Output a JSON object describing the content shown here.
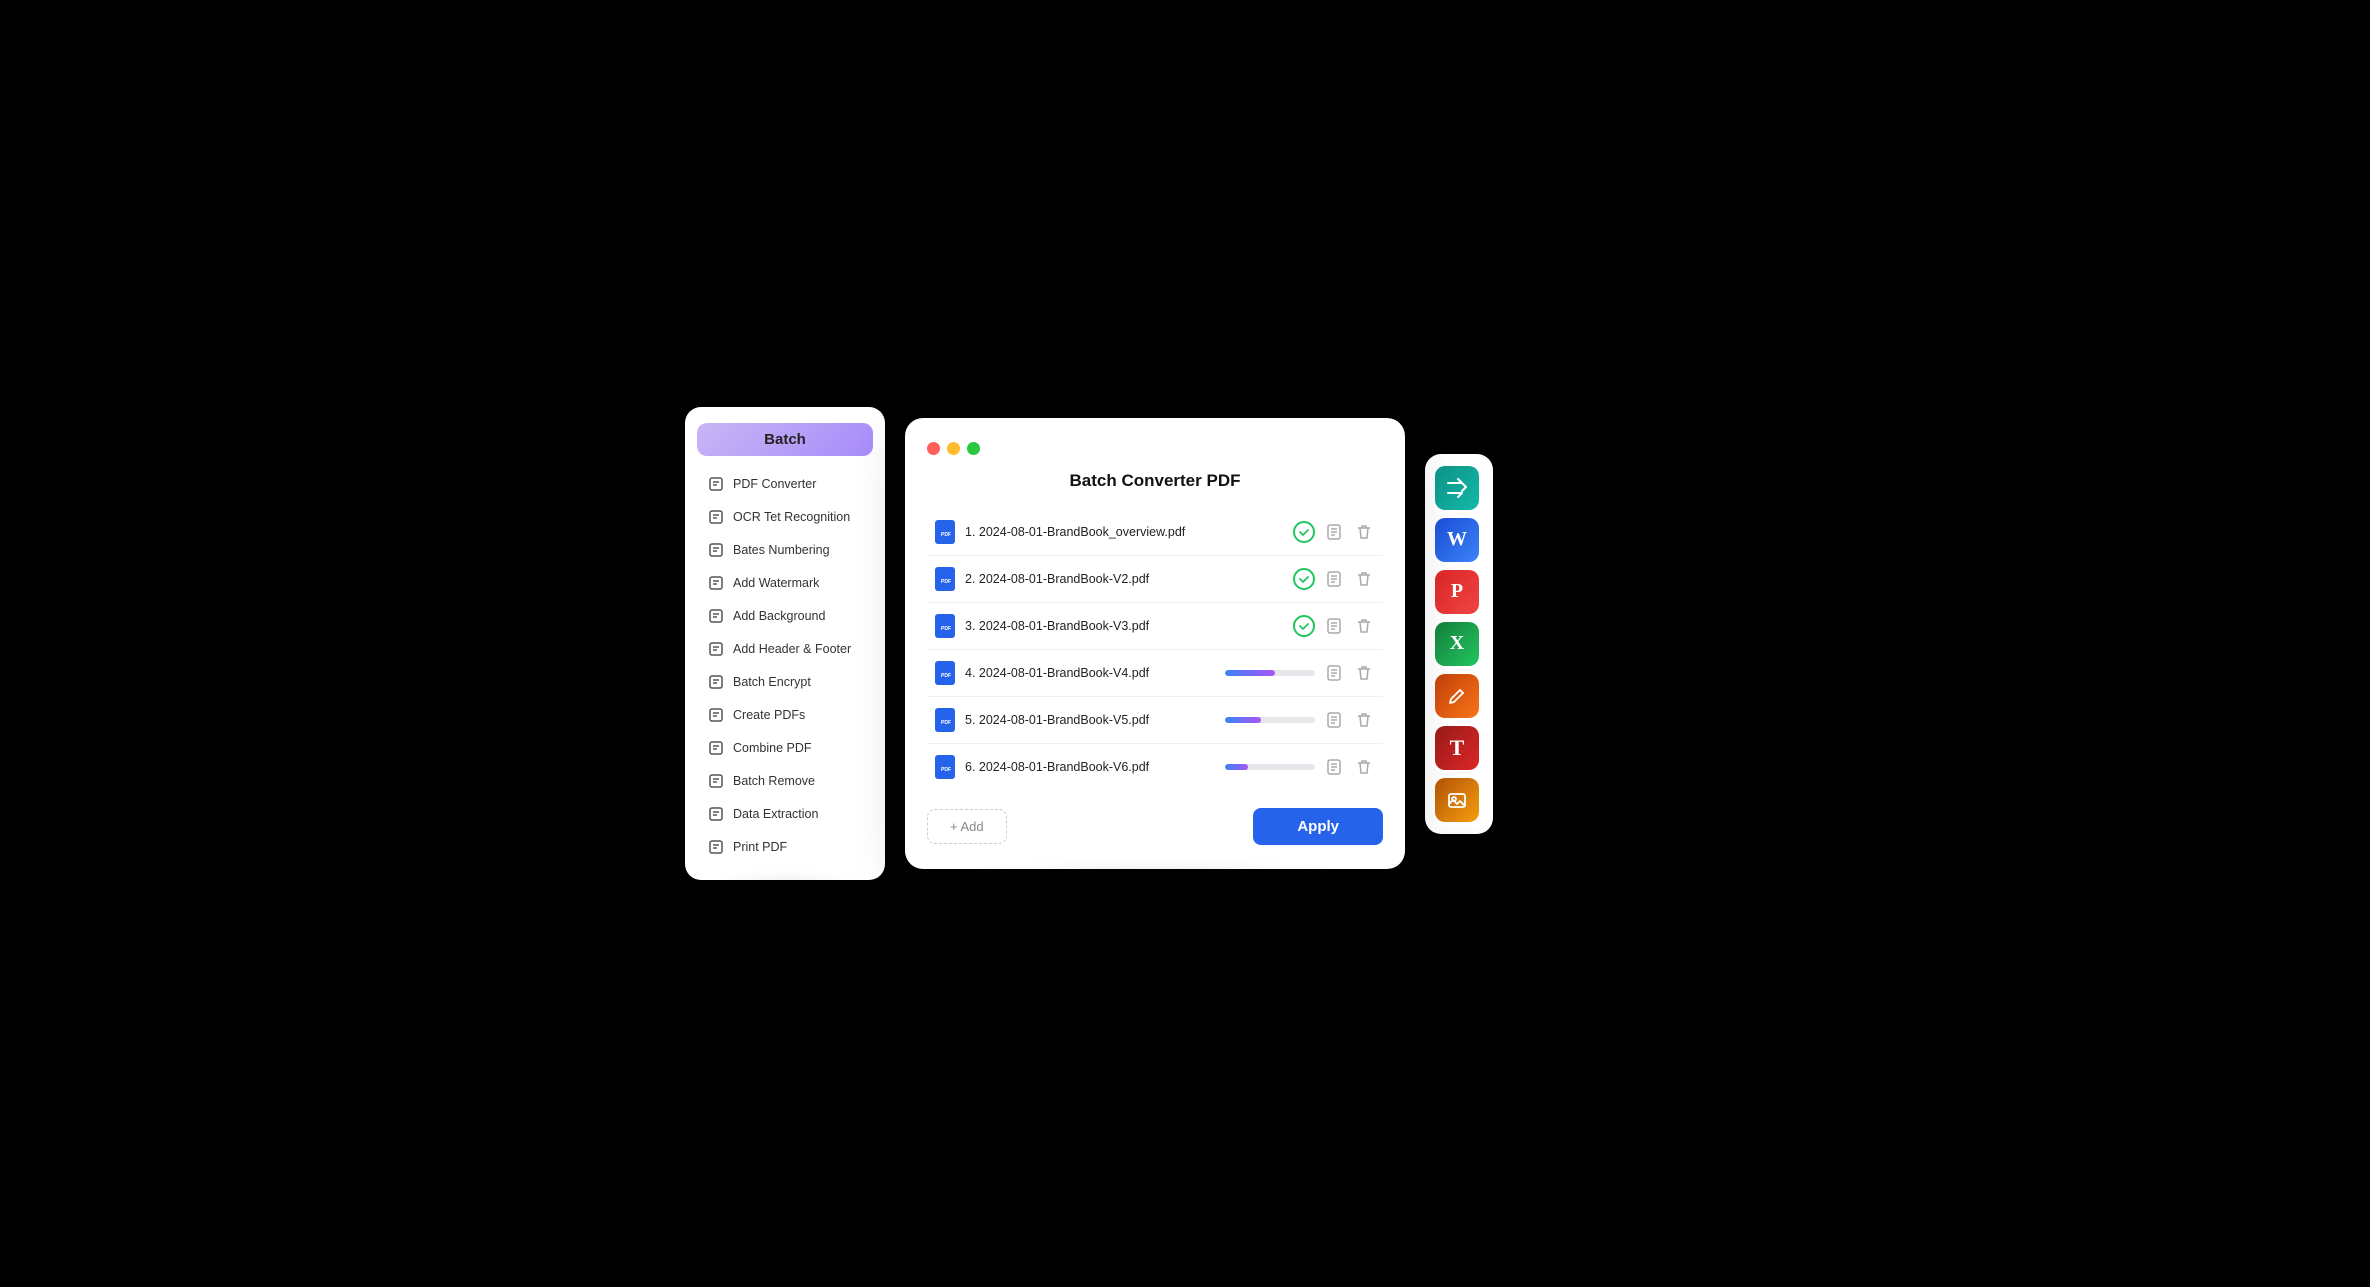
{
  "sidebar": {
    "header": "Batch",
    "items": [
      {
        "id": "pdf-converter",
        "label": "PDF Converter",
        "icon": "pdf-converter-icon"
      },
      {
        "id": "ocr-recognition",
        "label": "OCR Tet Recognition",
        "icon": "ocr-icon"
      },
      {
        "id": "bates-numbering",
        "label": "Bates Numbering",
        "icon": "bates-icon"
      },
      {
        "id": "add-watermark",
        "label": "Add Watermark",
        "icon": "watermark-icon"
      },
      {
        "id": "add-background",
        "label": "Add Background",
        "icon": "background-icon"
      },
      {
        "id": "add-header-footer",
        "label": "Add Header & Footer",
        "icon": "header-footer-icon"
      },
      {
        "id": "batch-encrypt",
        "label": "Batch Encrypt",
        "icon": "encrypt-icon"
      },
      {
        "id": "create-pdfs",
        "label": "Create PDFs",
        "icon": "create-pdf-icon"
      },
      {
        "id": "combine-pdf",
        "label": "Combine PDF",
        "icon": "combine-icon"
      },
      {
        "id": "batch-remove",
        "label": "Batch Remove",
        "icon": "remove-icon"
      },
      {
        "id": "data-extraction",
        "label": "Data Extraction",
        "icon": "extraction-icon"
      },
      {
        "id": "print-pdf",
        "label": "Print PDF",
        "icon": "print-icon"
      }
    ]
  },
  "main": {
    "title": "Batch Converter PDF",
    "files": [
      {
        "num": 1,
        "name": "2024-08-01-BrandBook_overview.pdf",
        "status": "done",
        "progress": 100
      },
      {
        "num": 2,
        "name": "2024-08-01-BrandBook-V2.pdf",
        "status": "done",
        "progress": 100
      },
      {
        "num": 3,
        "name": "2024-08-01-BrandBook-V3.pdf",
        "status": "done",
        "progress": 100
      },
      {
        "num": 4,
        "name": "2024-08-01-BrandBook-V4.pdf",
        "status": "progress",
        "progress": 55
      },
      {
        "num": 5,
        "name": "2024-08-01-BrandBook-V5.pdf",
        "status": "progress",
        "progress": 40
      },
      {
        "num": 6,
        "name": "2024-08-01-BrandBook-V6.pdf",
        "status": "progress",
        "progress": 25
      }
    ],
    "add_label": "+ Add",
    "apply_label": "Apply"
  },
  "dock": {
    "apps": [
      {
        "id": "app-shuffle",
        "color": "teal",
        "icon": "⇄"
      },
      {
        "id": "app-word",
        "color": "blue",
        "icon": "W"
      },
      {
        "id": "app-ppt",
        "color": "red",
        "icon": "P"
      },
      {
        "id": "app-excel",
        "color": "green",
        "icon": "X"
      },
      {
        "id": "app-edit",
        "color": "orange",
        "icon": "✏"
      },
      {
        "id": "app-text",
        "color": "red2",
        "icon": "T"
      },
      {
        "id": "app-photo",
        "color": "yellow",
        "icon": "✿"
      }
    ]
  },
  "traffic_lights": {
    "red": "#ff5f57",
    "yellow": "#ffbd2e",
    "green": "#28c840"
  }
}
